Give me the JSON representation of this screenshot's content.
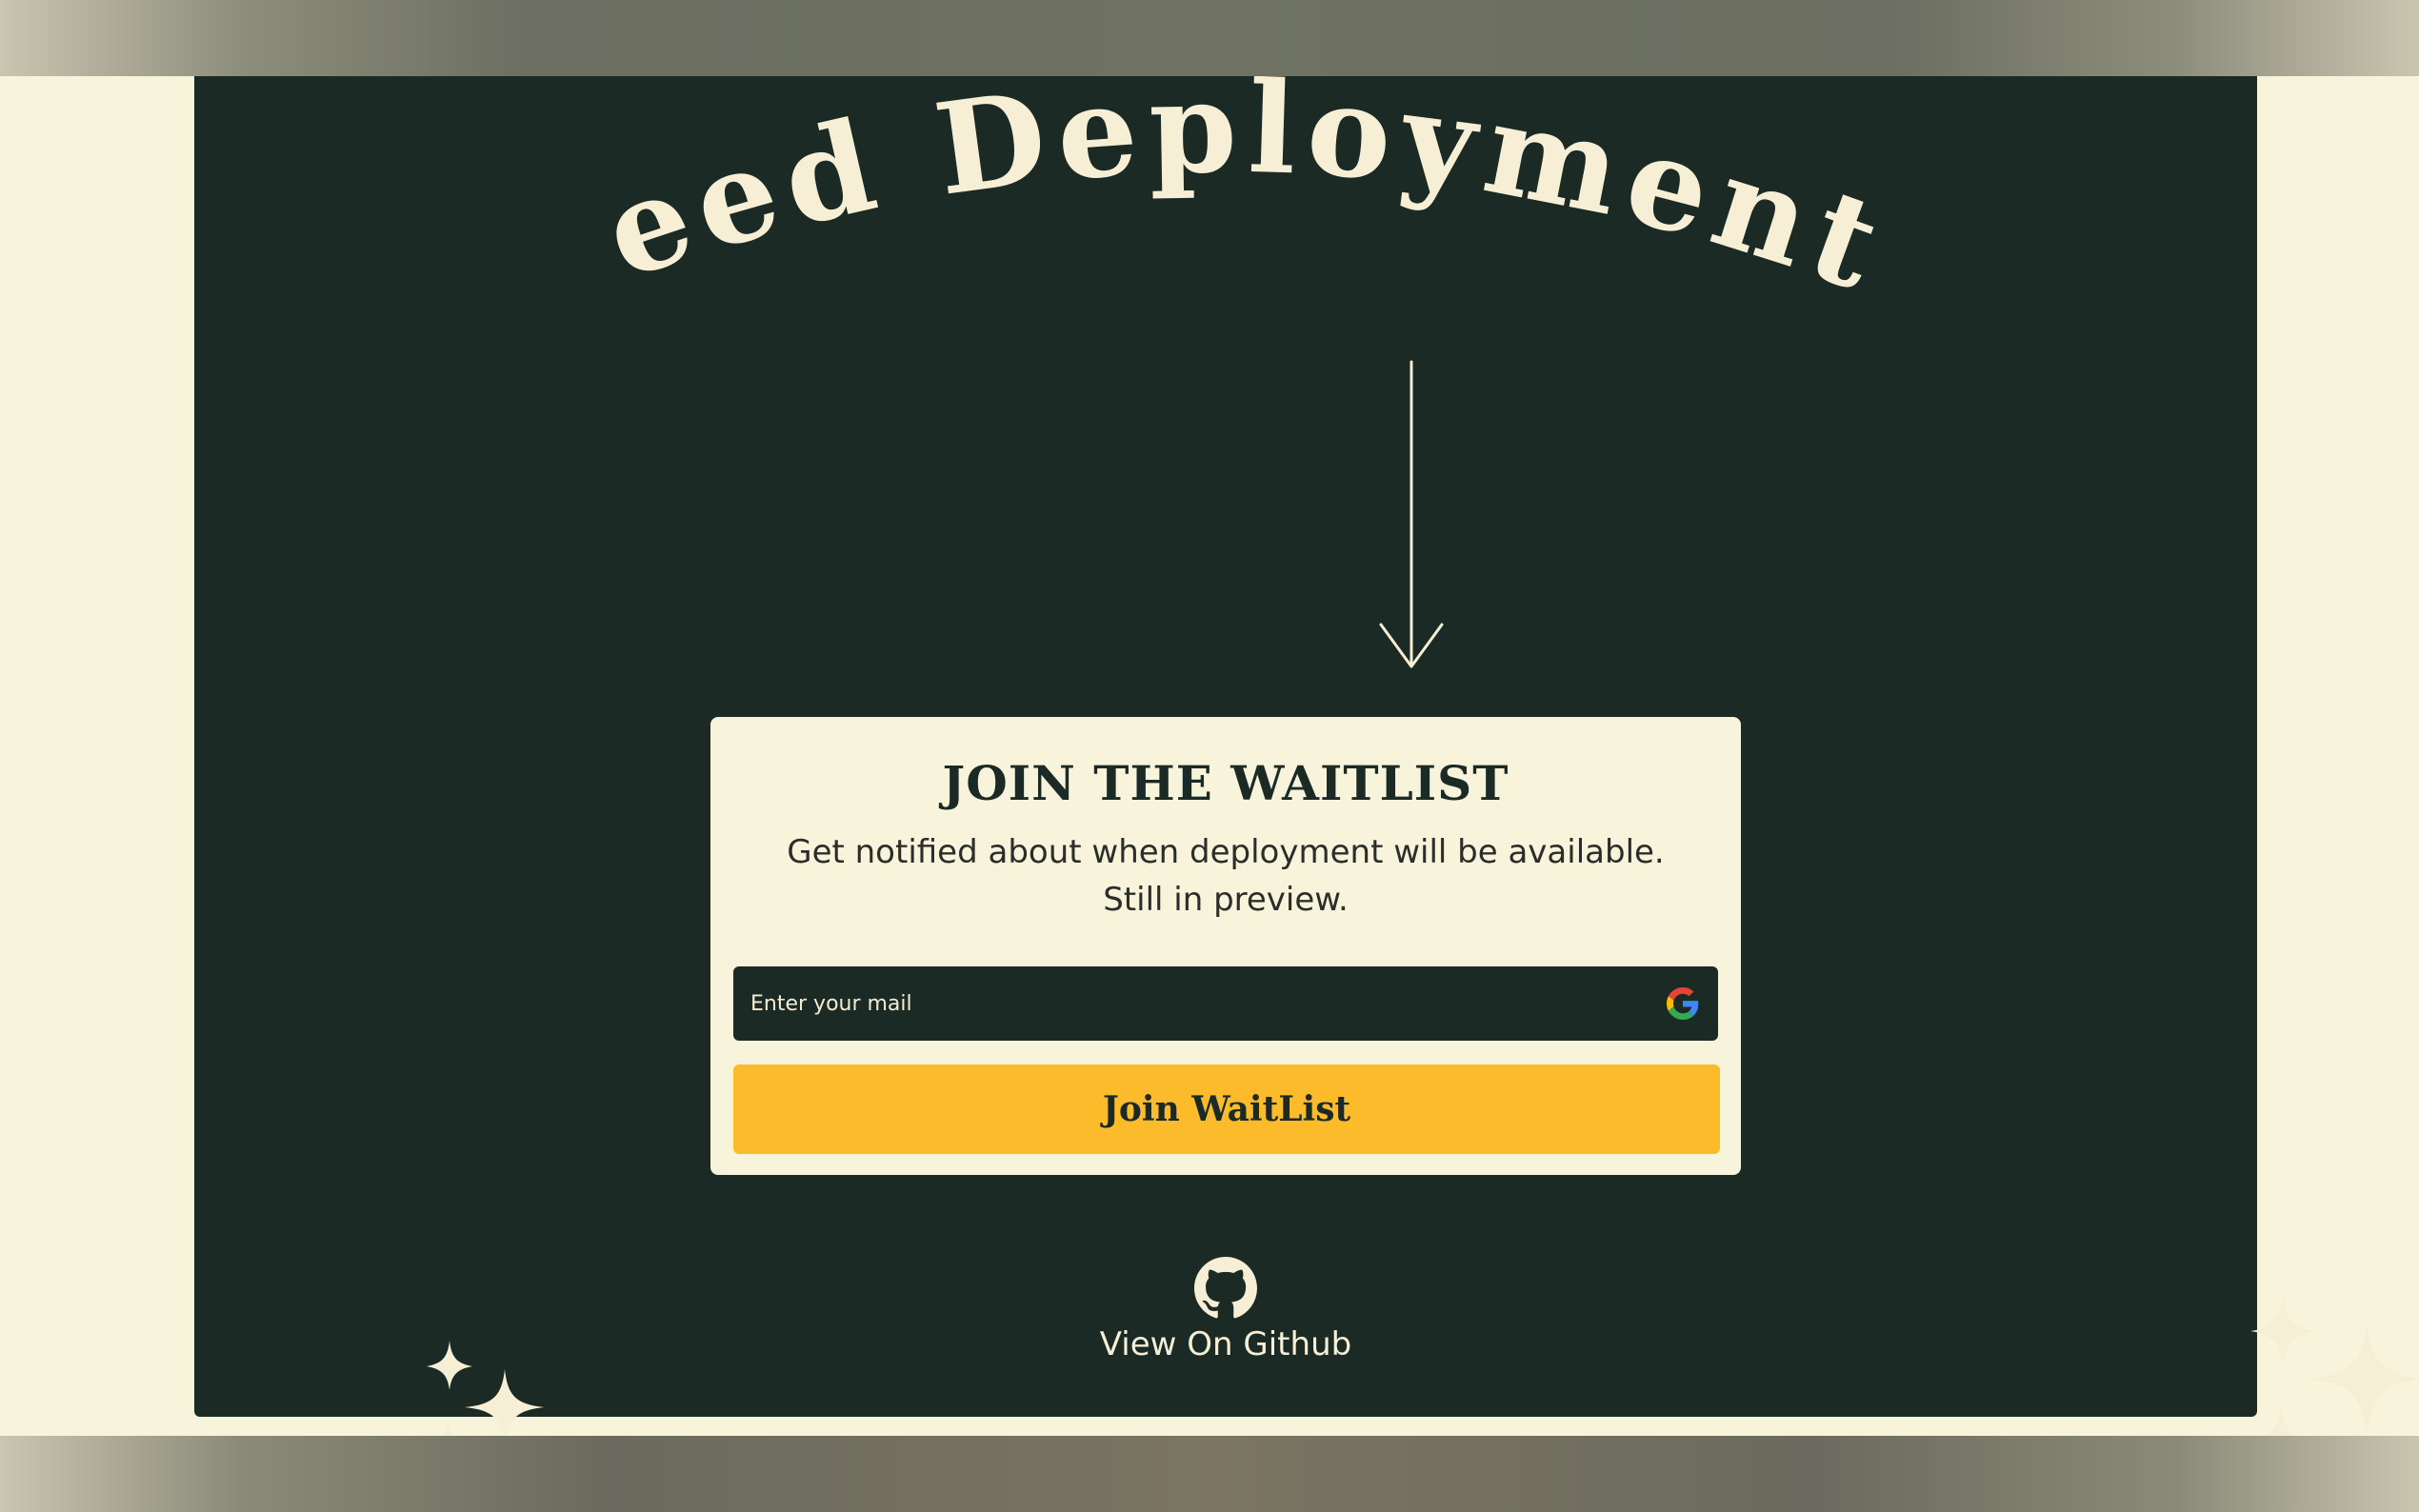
{
  "hero": {
    "headline": "Need Deployment?"
  },
  "waitlist": {
    "title": "JOIN THE WAITLIST",
    "subtitle": "Get notified about when deployment will be available. Still in preview.",
    "email_placeholder": "Enter your mail",
    "button_label": "Join WaitList"
  },
  "footer": {
    "github_label": "View On Github"
  },
  "icons": {
    "arrow": "arrow-down-icon",
    "google": "google-icon",
    "github": "github-icon",
    "sparkles": "sparkles-icon"
  },
  "colors": {
    "panel_bg": "#1b2a25",
    "cream": "#f8f4dc",
    "accent": "#fbbb2a"
  }
}
